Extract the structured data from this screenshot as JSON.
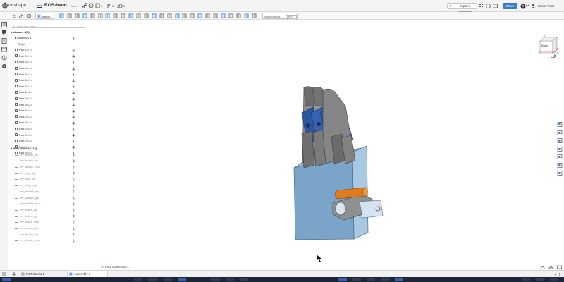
{
  "header": {
    "brand": "onshape",
    "doc_title": "ROS-hand",
    "doc_sub": "Main",
    "count_a": "0",
    "count_b": "0",
    "count_c": "0",
    "explore_label": "Explore Onshape",
    "share_label": "Share",
    "user_name": "Hisham Petra"
  },
  "toolbar": {
    "insert_label": "Insert",
    "search_label": "Search tools...",
    "search_shortcut": "alt/⌥ C"
  },
  "panel": {
    "filter_placeholder": "Filter by name",
    "instances_header": "Instances (26)",
    "assembly_label": "Assembly 1",
    "origin_label": "Origin",
    "parts": [
      "Part 1 <1>",
      "Part 2 <1>",
      "Part 3 <1>",
      "Part 4 <1>",
      "Part 5 <1>",
      "Part 6 <1>",
      "Part 7 <1>",
      "Part 1 <2>",
      "Part 2 <2>",
      "Part 3 <2>",
      "Part 4 <2>",
      "Part 2 <3>",
      "Part 3 <3>",
      "Part 2 <5>",
      "Part 4 <3>",
      "Part 2 <4>",
      "Part 3 <4>",
      "Part 4 <4>"
    ],
    "mates_header": "Mate features (15)",
    "mates": [
      "rev_twinky_dip",
      "rev_twinky_pip",
      "rev_twinky_mcp",
      "rev_ring_dip",
      "rev_ring_pip",
      "rev_ring_mcp",
      "rev_middle_dip",
      "rev_middle_pip",
      "rev_middle_mcp",
      "rev_index_dip",
      "rev_index_pip",
      "rev_index_mcp",
      "rev_thumb_dip",
      "rev_thumb_pip",
      "rev_thumb_mcp"
    ]
  },
  "viewcube": {
    "front_label": "Back"
  },
  "status": {
    "connection_text": "Poor connection..."
  },
  "tabs": {
    "part_studio": "Part Studio 1",
    "assembly": "Assembly 1"
  },
  "colors": {
    "accent": "#2b6fc9",
    "share_button": "#3b79c9",
    "model_blue": "#7aa5c8",
    "finger_gray": "#7c7c7c",
    "knuckle_blue": "#2d56a0",
    "thumb_orange": "#e07b1c"
  }
}
